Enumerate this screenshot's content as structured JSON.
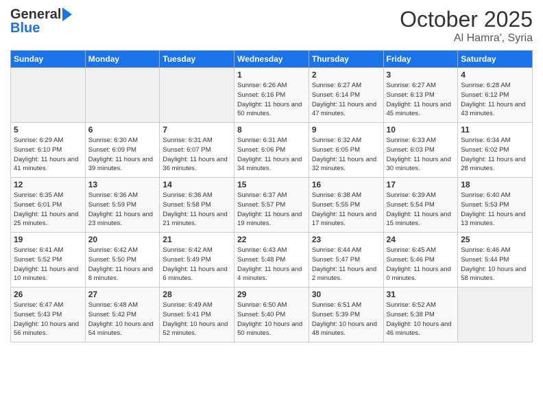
{
  "header": {
    "logo_line1": "General",
    "logo_line2": "Blue",
    "month": "October 2025",
    "location": "Al Hamra', Syria"
  },
  "weekdays": [
    "Sunday",
    "Monday",
    "Tuesday",
    "Wednesday",
    "Thursday",
    "Friday",
    "Saturday"
  ],
  "weeks": [
    [
      {
        "day": "",
        "info": ""
      },
      {
        "day": "",
        "info": ""
      },
      {
        "day": "",
        "info": ""
      },
      {
        "day": "1",
        "info": "Sunrise: 6:26 AM\nSunset: 6:16 PM\nDaylight: 11 hours\nand 50 minutes."
      },
      {
        "day": "2",
        "info": "Sunrise: 6:27 AM\nSunset: 6:14 PM\nDaylight: 11 hours\nand 47 minutes."
      },
      {
        "day": "3",
        "info": "Sunrise: 6:27 AM\nSunset: 6:13 PM\nDaylight: 11 hours\nand 45 minutes."
      },
      {
        "day": "4",
        "info": "Sunrise: 6:28 AM\nSunset: 6:12 PM\nDaylight: 11 hours\nand 43 minutes."
      }
    ],
    [
      {
        "day": "5",
        "info": "Sunrise: 6:29 AM\nSunset: 6:10 PM\nDaylight: 11 hours\nand 41 minutes."
      },
      {
        "day": "6",
        "info": "Sunrise: 6:30 AM\nSunset: 6:09 PM\nDaylight: 11 hours\nand 39 minutes."
      },
      {
        "day": "7",
        "info": "Sunrise: 6:31 AM\nSunset: 6:07 PM\nDaylight: 11 hours\nand 36 minutes."
      },
      {
        "day": "8",
        "info": "Sunrise: 6:31 AM\nSunset: 6:06 PM\nDaylight: 11 hours\nand 34 minutes."
      },
      {
        "day": "9",
        "info": "Sunrise: 6:32 AM\nSunset: 6:05 PM\nDaylight: 11 hours\nand 32 minutes."
      },
      {
        "day": "10",
        "info": "Sunrise: 6:33 AM\nSunset: 6:03 PM\nDaylight: 11 hours\nand 30 minutes."
      },
      {
        "day": "11",
        "info": "Sunrise: 6:34 AM\nSunset: 6:02 PM\nDaylight: 11 hours\nand 28 minutes."
      }
    ],
    [
      {
        "day": "12",
        "info": "Sunrise: 6:35 AM\nSunset: 6:01 PM\nDaylight: 11 hours\nand 25 minutes."
      },
      {
        "day": "13",
        "info": "Sunrise: 6:36 AM\nSunset: 5:59 PM\nDaylight: 11 hours\nand 23 minutes."
      },
      {
        "day": "14",
        "info": "Sunrise: 6:36 AM\nSunset: 5:58 PM\nDaylight: 11 hours\nand 21 minutes."
      },
      {
        "day": "15",
        "info": "Sunrise: 6:37 AM\nSunset: 5:57 PM\nDaylight: 11 hours\nand 19 minutes."
      },
      {
        "day": "16",
        "info": "Sunrise: 6:38 AM\nSunset: 5:55 PM\nDaylight: 11 hours\nand 17 minutes."
      },
      {
        "day": "17",
        "info": "Sunrise: 6:39 AM\nSunset: 5:54 PM\nDaylight: 11 hours\nand 15 minutes."
      },
      {
        "day": "18",
        "info": "Sunrise: 6:40 AM\nSunset: 5:53 PM\nDaylight: 11 hours\nand 13 minutes."
      }
    ],
    [
      {
        "day": "19",
        "info": "Sunrise: 6:41 AM\nSunset: 5:52 PM\nDaylight: 11 hours\nand 10 minutes."
      },
      {
        "day": "20",
        "info": "Sunrise: 6:42 AM\nSunset: 5:50 PM\nDaylight: 11 hours\nand 8 minutes."
      },
      {
        "day": "21",
        "info": "Sunrise: 6:42 AM\nSunset: 5:49 PM\nDaylight: 11 hours\nand 6 minutes."
      },
      {
        "day": "22",
        "info": "Sunrise: 6:43 AM\nSunset: 5:48 PM\nDaylight: 11 hours\nand 4 minutes."
      },
      {
        "day": "23",
        "info": "Sunrise: 6:44 AM\nSunset: 5:47 PM\nDaylight: 11 hours\nand 2 minutes."
      },
      {
        "day": "24",
        "info": "Sunrise: 6:45 AM\nSunset: 5:46 PM\nDaylight: 11 hours\nand 0 minutes."
      },
      {
        "day": "25",
        "info": "Sunrise: 6:46 AM\nSunset: 5:44 PM\nDaylight: 10 hours\nand 58 minutes."
      }
    ],
    [
      {
        "day": "26",
        "info": "Sunrise: 6:47 AM\nSunset: 5:43 PM\nDaylight: 10 hours\nand 56 minutes."
      },
      {
        "day": "27",
        "info": "Sunrise: 6:48 AM\nSunset: 5:42 PM\nDaylight: 10 hours\nand 54 minutes."
      },
      {
        "day": "28",
        "info": "Sunrise: 6:49 AM\nSunset: 5:41 PM\nDaylight: 10 hours\nand 52 minutes."
      },
      {
        "day": "29",
        "info": "Sunrise: 6:50 AM\nSunset: 5:40 PM\nDaylight: 10 hours\nand 50 minutes."
      },
      {
        "day": "30",
        "info": "Sunrise: 6:51 AM\nSunset: 5:39 PM\nDaylight: 10 hours\nand 48 minutes."
      },
      {
        "day": "31",
        "info": "Sunrise: 6:52 AM\nSunset: 5:38 PM\nDaylight: 10 hours\nand 46 minutes."
      },
      {
        "day": "",
        "info": ""
      }
    ]
  ]
}
